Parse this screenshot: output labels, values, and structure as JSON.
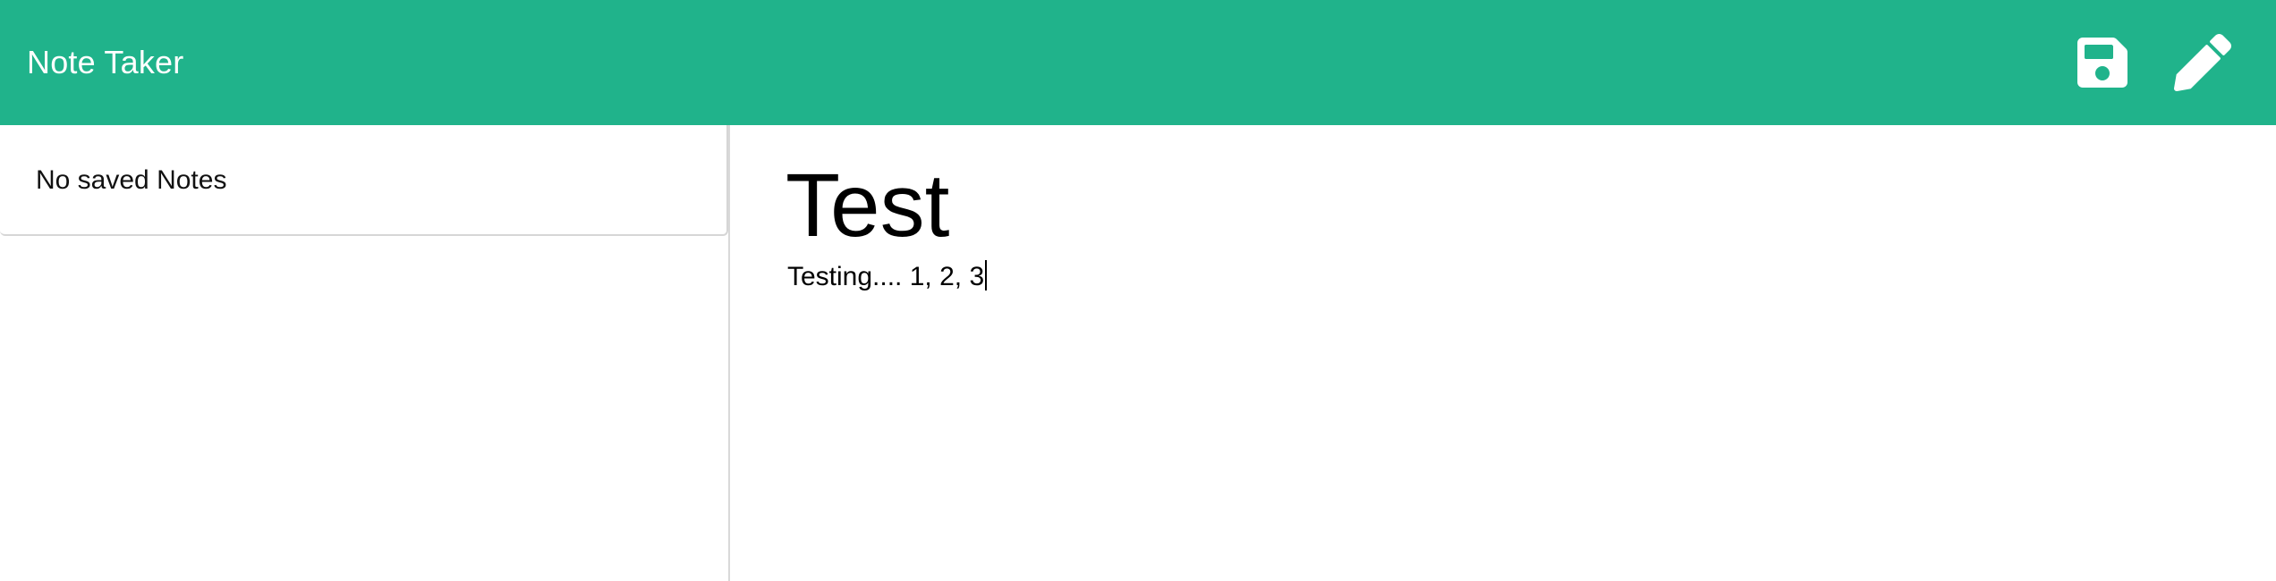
{
  "app": {
    "title": "Note Taker",
    "brand_color": "#20b38b"
  },
  "toolbar": {
    "save_icon": "save-icon",
    "new_note_icon": "pencil-icon"
  },
  "sidebar": {
    "empty_message": "No saved Notes"
  },
  "editor": {
    "title_value": "Test",
    "body_value": "Testing.... 1, 2, 3"
  }
}
